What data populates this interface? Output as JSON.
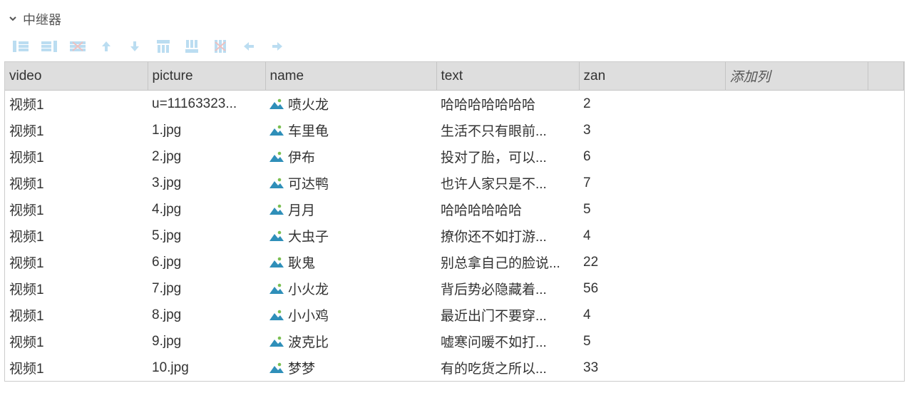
{
  "section": {
    "title": "中继器"
  },
  "toolbar_icons": [
    "insert-row-before-icon",
    "insert-row-after-icon",
    "delete-row-icon",
    "arrow-up-icon",
    "arrow-down-icon",
    "insert-col-before-icon",
    "insert-col-after-icon",
    "delete-col-icon",
    "arrow-left-icon",
    "arrow-right-icon"
  ],
  "columns": {
    "video": "video",
    "picture": "picture",
    "name": "name",
    "text": "text",
    "zan": "zan",
    "add": "添加列"
  },
  "rows": [
    {
      "video": "视频1",
      "picture": "u=11163323...",
      "name_icon": "image-icon",
      "name": "喷火龙",
      "text": "哈哈哈哈哈哈哈",
      "zan": "2"
    },
    {
      "video": "视频1",
      "picture": "1.jpg",
      "name_icon": "image-icon",
      "name": "车里龟",
      "text": "生活不只有眼前...",
      "zan": "3"
    },
    {
      "video": "视频1",
      "picture": "2.jpg",
      "name_icon": "image-icon",
      "name": "伊布",
      "text": "投对了胎，可以...",
      "zan": "6"
    },
    {
      "video": "视频1",
      "picture": "3.jpg",
      "name_icon": "image-icon",
      "name": "可达鸭",
      "text": "也许人家只是不...",
      "zan": "7"
    },
    {
      "video": "视频1",
      "picture": "4.jpg",
      "name_icon": "image-icon",
      "name": "月月",
      "text": "哈哈哈哈哈哈",
      "zan": "5"
    },
    {
      "video": "视频1",
      "picture": "5.jpg",
      "name_icon": "image-icon",
      "name": "大虫子",
      "text": "撩你还不如打游...",
      "zan": "4"
    },
    {
      "video": "视频1",
      "picture": "6.jpg",
      "name_icon": "image-icon",
      "name": "耿鬼",
      "text": "别总拿自己的脸说...",
      "zan": "22"
    },
    {
      "video": "视频1",
      "picture": "7.jpg",
      "name_icon": "image-icon",
      "name": "小火龙",
      "text": "背后势必隐藏着...",
      "zan": "56"
    },
    {
      "video": "视频1",
      "picture": "8.jpg",
      "name_icon": "image-icon",
      "name": "小小鸡",
      "text": "最近出门不要穿...",
      "zan": "4"
    },
    {
      "video": "视频1",
      "picture": "9.jpg",
      "name_icon": "image-icon",
      "name": "波克比",
      "text": "嘘寒问暖不如打...",
      "zan": "5"
    },
    {
      "video": "视频1",
      "picture": "10.jpg",
      "name_icon": "image-icon",
      "name": "梦梦",
      "text": "有的吃货之所以...",
      "zan": "33"
    }
  ]
}
